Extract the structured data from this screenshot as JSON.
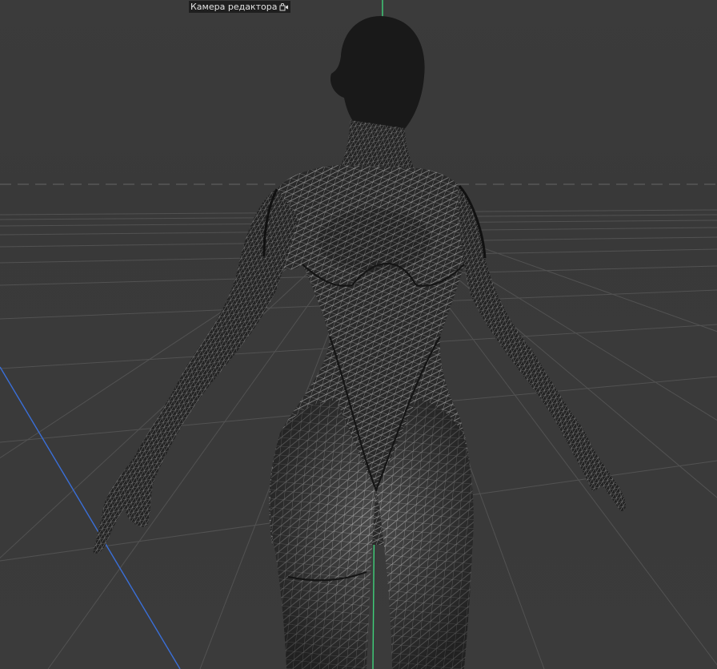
{
  "viewport": {
    "camera_label": "Камера редактора",
    "camera_icon": "camera-lock-icon",
    "colors": {
      "background": "#3a3a3a",
      "grid": "#5a5a5a",
      "horizon_dash": "#6a6a6a",
      "y_axis": "#3fd17a",
      "z_axis": "#3a6fd8",
      "mesh_fill": "#1c1c1c",
      "wire": "#bdbdbd"
    }
  }
}
